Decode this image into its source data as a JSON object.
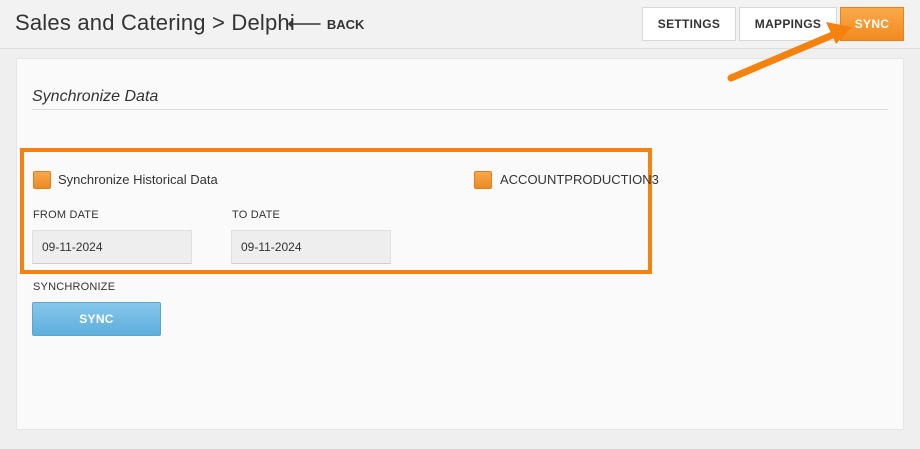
{
  "header": {
    "title": "Sales and Catering > Delphi",
    "back_label": "BACK",
    "buttons": {
      "settings": "SETTINGS",
      "mappings": "MAPPINGS",
      "sync": "SYNC"
    }
  },
  "section": {
    "title": "Synchronize Data",
    "historical_checkbox_label": "Synchronize Historical Data",
    "account_checkbox_label": "ACCOUNTPRODUCTION3",
    "from_date_label": "FROM DATE",
    "from_date_value": "09-11-2024",
    "to_date_label": "TO DATE",
    "to_date_value": "09-11-2024",
    "synchronize_label": "SYNCHRONIZE",
    "sync_button_label": "SYNC"
  },
  "colors": {
    "accent_orange": "#f28a1f",
    "sync_blue": "#5eaedc",
    "annotation_orange": "#f5820f"
  },
  "icons": {
    "back": "left-arrow-icon"
  }
}
